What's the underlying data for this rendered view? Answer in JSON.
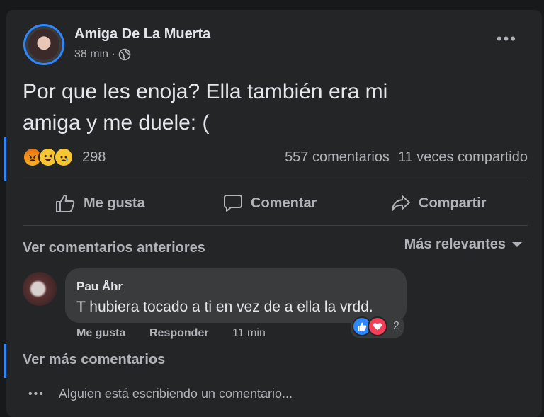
{
  "post": {
    "author": "Amiga De La Muerta",
    "time": "38 min ·",
    "text_line1": "Por que les enoja? Ella también era mi",
    "text_line2": "amiga y me duele: (",
    "more_label": "•••",
    "reaction_count": "298",
    "comments_count": "557 comentarios",
    "shares_count": "11 veces compartido"
  },
  "actions": {
    "like": "Me gusta",
    "comment": "Comentar",
    "share": "Compartir"
  },
  "comments": {
    "view_previous": "Ver comentarios anteriores",
    "sort": "Más relevantes",
    "view_more": "Ver más comentarios",
    "typing": "Alguien está escribiendo un comentario...",
    "typing_dots": "•••",
    "items": [
      {
        "author": "Pau Åhr",
        "text": "T hubiera tocado a ti en vez de a ella la vrdd.",
        "like_label": "Me gusta",
        "reply_label": "Responder",
        "time": "11 min",
        "reaction_count": "2"
      }
    ]
  },
  "colors": {
    "background": "#18191a",
    "card": "#242526",
    "bubble": "#3a3b3c",
    "text_primary": "#e4e6eb",
    "text_secondary": "#b0b3b8",
    "accent": "#2d88ff"
  },
  "icons": {
    "reactions": [
      "angry-react-icon",
      "haha-react-icon",
      "sad-react-icon"
    ],
    "privacy": "globe-icon",
    "comment_reactions": [
      "like-react-icon",
      "love-react-icon"
    ]
  }
}
